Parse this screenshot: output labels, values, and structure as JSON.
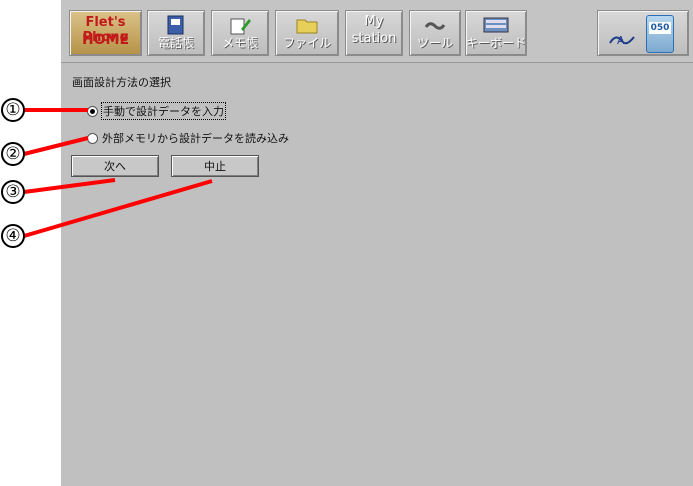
{
  "toolbar": {
    "home": {
      "line1": "Flet's Phone",
      "line2": "HOME",
      "icon": "home-logo"
    },
    "buttons": [
      {
        "label": "電話帳",
        "icon": "phonebook-icon"
      },
      {
        "label": "メモ帳",
        "icon": "memo-pad-icon"
      },
      {
        "label": "ファイル",
        "icon": "folder-icon"
      },
      {
        "label_top": "My",
        "label": "station",
        "icon": "my-station"
      },
      {
        "label": "ツール",
        "icon": "tools-icon"
      },
      {
        "label": "キーボード",
        "icon": "keyboard-icon"
      }
    ],
    "status": {
      "number": "050",
      "icon": "phone-status-icon"
    }
  },
  "form": {
    "heading": "画面設計方法の選択",
    "options": [
      {
        "label": "手動で設計データを入力",
        "selected": true
      },
      {
        "label": "外部メモリから設計データを読み込み",
        "selected": false
      }
    ],
    "next_button": "次へ",
    "cancel_button": "中止"
  },
  "callouts": [
    "①",
    "②",
    "③",
    "④"
  ],
  "colors": {
    "callout_line": "#ff0000",
    "home_text": "#c21a1a",
    "screen_bg": "#c0c0c0"
  }
}
